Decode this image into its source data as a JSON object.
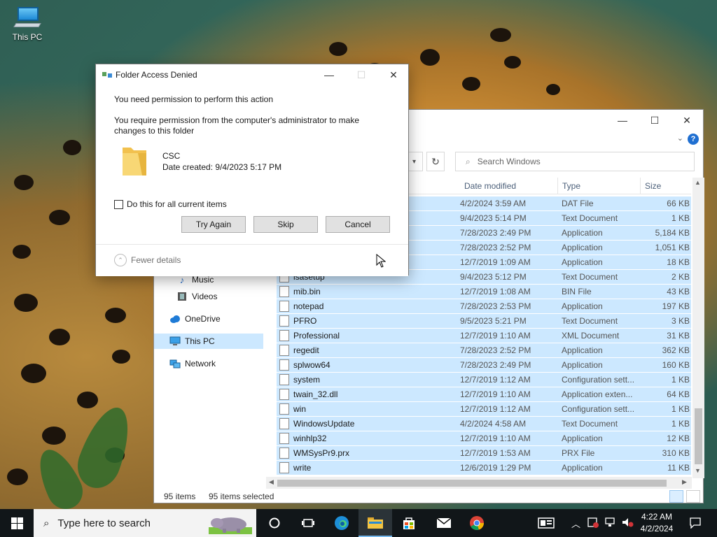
{
  "desktop": {
    "icon_label": "This PC"
  },
  "explorer": {
    "search_placeholder": "Search Windows",
    "columns": {
      "date": "Date modified",
      "type": "Type",
      "size": "Size"
    },
    "nav": {
      "music": "Music",
      "videos": "Videos",
      "onedrive": "OneDrive",
      "thispc": "This PC",
      "network": "Network"
    },
    "rows": [
      {
        "name": "",
        "date": "4/2/2024 3:59 AM",
        "type": "DAT File",
        "size": "66 KB"
      },
      {
        "name": "",
        "date": "9/4/2023 5:14 PM",
        "type": "Text Document",
        "size": "1 KB"
      },
      {
        "name": "",
        "date": "7/28/2023 2:49 PM",
        "type": "Application",
        "size": "5,184 KB"
      },
      {
        "name": "",
        "date": "7/28/2023 2:52 PM",
        "type": "Application",
        "size": "1,051 KB"
      },
      {
        "name": "",
        "date": "12/7/2019 1:09 AM",
        "type": "Application",
        "size": "18 KB"
      },
      {
        "name": "isasetup",
        "date": "9/4/2023 5:12 PM",
        "type": "Text Document",
        "size": "2 KB"
      },
      {
        "name": "mib.bin",
        "date": "12/7/2019 1:08 AM",
        "type": "BIN File",
        "size": "43 KB"
      },
      {
        "name": "notepad",
        "date": "7/28/2023 2:53 PM",
        "type": "Application",
        "size": "197 KB"
      },
      {
        "name": "PFRO",
        "date": "9/5/2023 5:21 PM",
        "type": "Text Document",
        "size": "3 KB"
      },
      {
        "name": "Professional",
        "date": "12/7/2019 1:10 AM",
        "type": "XML Document",
        "size": "31 KB"
      },
      {
        "name": "regedit",
        "date": "7/28/2023 2:52 PM",
        "type": "Application",
        "size": "362 KB"
      },
      {
        "name": "splwow64",
        "date": "7/28/2023 2:49 PM",
        "type": "Application",
        "size": "160 KB"
      },
      {
        "name": "system",
        "date": "12/7/2019 1:12 AM",
        "type": "Configuration sett...",
        "size": "1 KB"
      },
      {
        "name": "twain_32.dll",
        "date": "12/7/2019 1:10 AM",
        "type": "Application exten...",
        "size": "64 KB"
      },
      {
        "name": "win",
        "date": "12/7/2019 1:12 AM",
        "type": "Configuration sett...",
        "size": "1 KB"
      },
      {
        "name": "WindowsUpdate",
        "date": "4/2/2024 4:58 AM",
        "type": "Text Document",
        "size": "1 KB"
      },
      {
        "name": "winhlp32",
        "date": "12/7/2019 1:10 AM",
        "type": "Application",
        "size": "12 KB"
      },
      {
        "name": "WMSysPr9.prx",
        "date": "12/7/2019 1:53 AM",
        "type": "PRX File",
        "size": "310 KB"
      },
      {
        "name": "write",
        "date": "12/6/2019 1:29 PM",
        "type": "Application",
        "size": "11 KB"
      }
    ],
    "status": {
      "items": "95 items",
      "selected": "95 items selected"
    }
  },
  "dialog": {
    "title": "Folder Access Denied",
    "msg1": "You need permission to perform this action",
    "msg2a": "You require permission from the computer's administrator to make",
    "msg2b": "changes to this folder",
    "folder_name": "CSC",
    "folder_date": "Date created: 9/4/2023 5:17 PM",
    "checkbox_label": "Do this for all current items",
    "buttons": {
      "try_again": "Try Again",
      "skip": "Skip",
      "cancel": "Cancel"
    },
    "fewer_details": "Fewer details"
  },
  "taskbar": {
    "search_placeholder": "Type here to search",
    "time": "4:22 AM",
    "date": "4/2/2024"
  },
  "colors": {
    "selection": "#cce8ff",
    "taskbar": "#111619",
    "accent": "#1f6fd1"
  }
}
